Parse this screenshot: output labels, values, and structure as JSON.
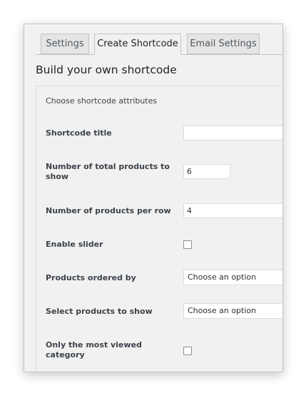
{
  "tabs": [
    {
      "label": "Settings",
      "active": false
    },
    {
      "label": "Create Shortcode",
      "active": true
    },
    {
      "label": "Email Settings",
      "active": false
    }
  ],
  "heading": "Build your own shortcode",
  "panel": {
    "subtitle": "Choose shortcode attributes",
    "shortcode_title": {
      "label": "Shortcode title",
      "value": ""
    },
    "total_products": {
      "label": "Number of total products to show",
      "value": "6"
    },
    "products_per_row": {
      "label": "Number of products per row",
      "value": "4"
    },
    "enable_slider": {
      "label": "Enable slider",
      "checked": false
    },
    "ordered_by": {
      "label": "Products ordered by",
      "value": "Choose an option"
    },
    "products_to_show": {
      "label": "Select products to show",
      "value": "Choose an option"
    },
    "most_viewed_category": {
      "label": "Only the most viewed category",
      "checked": false
    }
  }
}
